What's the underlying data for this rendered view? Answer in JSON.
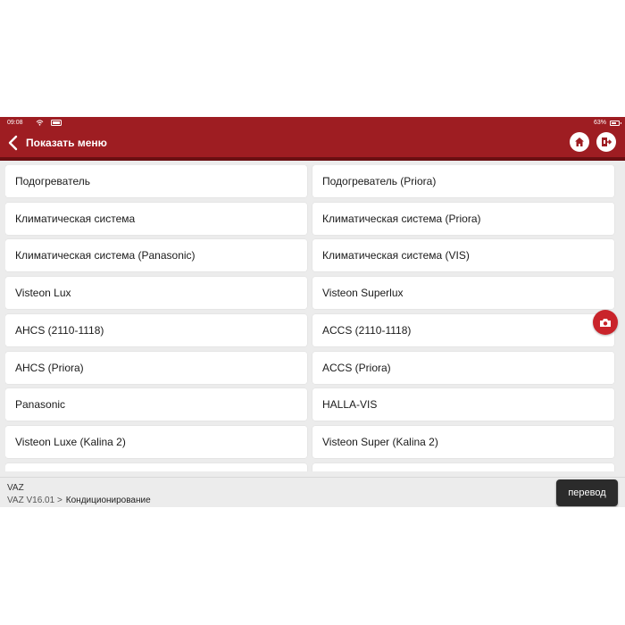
{
  "status_bar": {
    "time": "09:08",
    "battery": "63%"
  },
  "header": {
    "title": "Показать меню"
  },
  "menu": [
    {
      "label": "Подогреватель"
    },
    {
      "label": "Подогреватель (Priora)"
    },
    {
      "label": "Климатическая система"
    },
    {
      "label": "Климатическая система (Priora)"
    },
    {
      "label": "Климатическая система (Panasonic)"
    },
    {
      "label": "Климатическая система (VIS)"
    },
    {
      "label": "Visteon Lux"
    },
    {
      "label": "Visteon Superlux"
    },
    {
      "label": "AHCS (2110-1118)"
    },
    {
      "label": "ACCS (2110-1118)"
    },
    {
      "label": "AHCS (Priora)"
    },
    {
      "label": "ACCS (Priora)"
    },
    {
      "label": "Panasonic"
    },
    {
      "label": "HALLA-VIS"
    },
    {
      "label": "Visteon Luxe (Kalina 2)"
    },
    {
      "label": "Visteon Super (Kalina 2)"
    },
    {
      "label": ""
    },
    {
      "label": ""
    }
  ],
  "footer": {
    "line1": "VAZ",
    "version": "VAZ V16.01 >",
    "current": "Кондиционирование",
    "translate_label": "перевод"
  },
  "colors": {
    "accent": "#9e1d22",
    "accent_dark": "#6a0f12",
    "camera": "#c9242b"
  }
}
